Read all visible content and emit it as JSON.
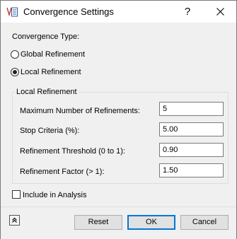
{
  "window": {
    "title": "Convergence Settings",
    "help_label": "?"
  },
  "convergence_type": {
    "label": "Convergence Type:",
    "options": [
      {
        "label": "Global Refinement",
        "checked": false
      },
      {
        "label": "Local Refinement",
        "checked": true
      }
    ]
  },
  "local_refinement": {
    "group_title": "Local Refinement",
    "fields": [
      {
        "label": "Maximum Number of Refinements:",
        "value": "5"
      },
      {
        "label": "Stop Criteria (%):",
        "value": "5.00"
      },
      {
        "label": "Refinement Threshold (0 to 1):",
        "value": "0.90"
      },
      {
        "label": "Refinement Factor (> 1):",
        "value": "1.50"
      }
    ]
  },
  "include_in_analysis": {
    "label": "Include in Analysis",
    "checked": false
  },
  "buttons": {
    "reset": "Reset",
    "ok": "OK",
    "cancel": "Cancel"
  },
  "icons": {
    "app": "convergence-settings-icon",
    "help": "help-icon",
    "close": "close-icon",
    "expand": "double-chevron-up-icon"
  },
  "colors": {
    "accent": "#0078d7",
    "window_bg": "#f0f0f0",
    "title_bg": "#ffffff"
  }
}
